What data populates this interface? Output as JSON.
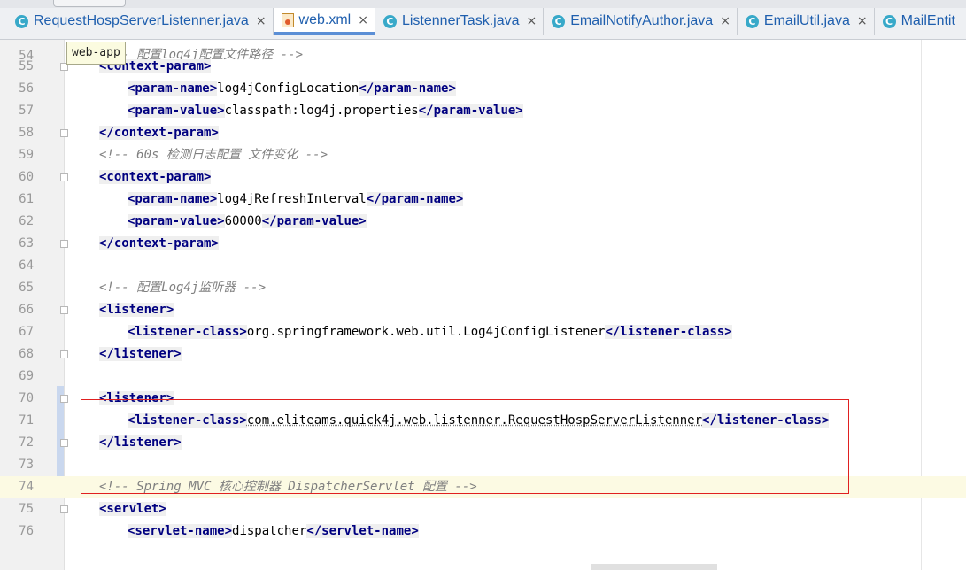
{
  "tabs": [
    {
      "label": "RequestHospServerListenner.java",
      "icon": "java-class-icon",
      "active": false
    },
    {
      "label": "web.xml",
      "icon": "xml-file-icon",
      "active": true
    },
    {
      "label": "ListennerTask.java",
      "icon": "java-class-icon",
      "active": false
    },
    {
      "label": "EmailNotifyAuthor.java",
      "icon": "java-class-icon",
      "active": false
    },
    {
      "label": "EmailUtil.java",
      "icon": "java-class-icon",
      "active": false
    },
    {
      "label": "MailEntit",
      "icon": "java-class-icon",
      "active": false
    }
  ],
  "tab_close_glyph": "×",
  "tab_icon_letter": "C",
  "tooltip": "web-app",
  "partial_line": {
    "number": "54",
    "text": "<!-- 配置log4j配置文件路径 -->"
  },
  "lines": [
    {
      "n": "55",
      "parts": [
        {
          "t": "tag",
          "v": "<context-param>"
        }
      ]
    },
    {
      "n": "56",
      "parts": [
        {
          "t": "tag",
          "v": "<param-name>"
        },
        {
          "t": "txt",
          "v": "log4jConfigLocation"
        },
        {
          "t": "tag",
          "v": "</param-name>"
        }
      ]
    },
    {
      "n": "57",
      "parts": [
        {
          "t": "tag",
          "v": "<param-value>"
        },
        {
          "t": "txt",
          "v": "classpath:log4j.properties"
        },
        {
          "t": "tag",
          "v": "</param-value>"
        }
      ]
    },
    {
      "n": "58",
      "parts": [
        {
          "t": "tag",
          "v": "</context-param>"
        }
      ]
    },
    {
      "n": "59",
      "parts": [
        {
          "t": "cmt",
          "v": "<!-- 60s 检测日志配置 文件变化 -->"
        }
      ]
    },
    {
      "n": "60",
      "parts": [
        {
          "t": "tag",
          "v": "<context-param>"
        }
      ]
    },
    {
      "n": "61",
      "parts": [
        {
          "t": "tag",
          "v": "<param-name>"
        },
        {
          "t": "txt",
          "v": "log4jRefreshInterval"
        },
        {
          "t": "tag",
          "v": "</param-name>"
        }
      ]
    },
    {
      "n": "62",
      "parts": [
        {
          "t": "tag",
          "v": "<param-value>"
        },
        {
          "t": "txt",
          "v": "60000"
        },
        {
          "t": "tag",
          "v": "</param-value>"
        }
      ]
    },
    {
      "n": "63",
      "parts": [
        {
          "t": "tag",
          "v": "</context-param>"
        }
      ]
    },
    {
      "n": "64",
      "parts": []
    },
    {
      "n": "65",
      "parts": [
        {
          "t": "cmt",
          "v": "<!-- 配置Log4j监听器 -->"
        }
      ]
    },
    {
      "n": "66",
      "parts": [
        {
          "t": "tag",
          "v": "<listener>"
        }
      ]
    },
    {
      "n": "67",
      "parts": [
        {
          "t": "tag",
          "v": "<listener-class>"
        },
        {
          "t": "txt",
          "v": "org.springframework.web.util.Log4jConfigListener"
        },
        {
          "t": "tag",
          "v": "</listener-class>"
        }
      ]
    },
    {
      "n": "68",
      "parts": [
        {
          "t": "tag",
          "v": "</listener>"
        }
      ]
    },
    {
      "n": "69",
      "parts": []
    },
    {
      "n": "70",
      "parts": [
        {
          "t": "tag",
          "v": "<listener>"
        }
      ]
    },
    {
      "n": "71",
      "parts": [
        {
          "t": "tag",
          "v": "<listener-class>"
        },
        {
          "t": "txt",
          "v": "com.eliteams.quick4j.web.listenner.RequestHospServerListenner"
        },
        {
          "t": "tag",
          "v": "</listener-class>"
        }
      ]
    },
    {
      "n": "72",
      "parts": [
        {
          "t": "tag",
          "v": "</listener>"
        }
      ]
    },
    {
      "n": "73",
      "parts": []
    },
    {
      "n": "74",
      "parts": [
        {
          "t": "cmt",
          "v": "<!-- Spring MVC 核心控制器 DispatcherServlet 配置 -->"
        }
      ]
    },
    {
      "n": "75",
      "parts": [
        {
          "t": "tag",
          "v": "<servlet>"
        }
      ]
    },
    {
      "n": "76",
      "parts": [
        {
          "t": "tag",
          "v": "<servlet-name>"
        },
        {
          "t": "txt",
          "v": "dispatcher"
        },
        {
          "t": "tag",
          "v": "</servlet-name>"
        }
      ]
    }
  ],
  "current_line": "74",
  "colors": {
    "tag_fg": "#000080",
    "tag_bg": "#efefef",
    "comment": "#808080",
    "highlight_box": "#e02020",
    "current_line_bg": "#fcfae3"
  }
}
